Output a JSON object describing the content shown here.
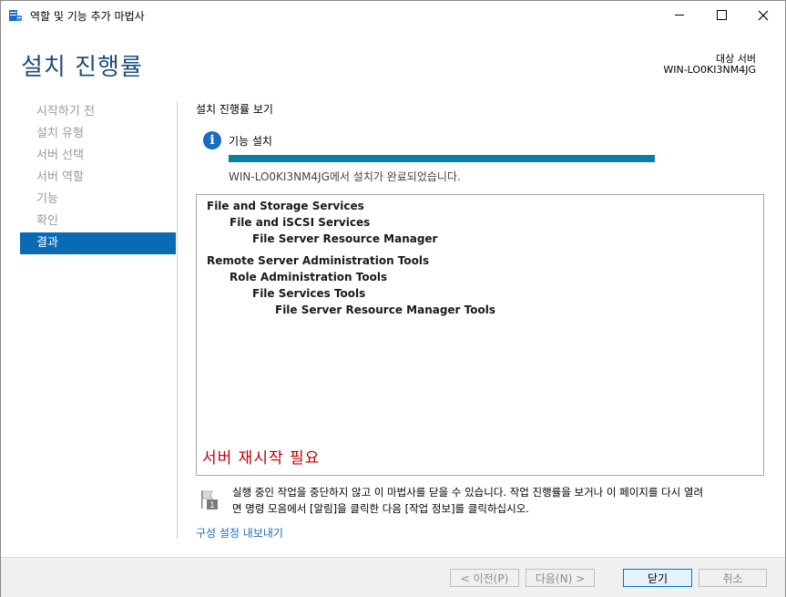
{
  "window": {
    "title": "역할 및 기능 추가 마법사"
  },
  "header": {
    "title": "설치 진행률",
    "destination_label": "대상 서버",
    "destination_server": "WIN-LO0KI3NM4JG"
  },
  "nav": {
    "items": [
      {
        "label": "시작하기 전",
        "active": false
      },
      {
        "label": "설치 유형",
        "active": false
      },
      {
        "label": "서버 선택",
        "active": false
      },
      {
        "label": "서버 역할",
        "active": false
      },
      {
        "label": "기능",
        "active": false
      },
      {
        "label": "확인",
        "active": false
      },
      {
        "label": "결과",
        "active": true
      }
    ]
  },
  "content": {
    "heading": "설치 진행률 보기",
    "info_icon": "info-icon",
    "feature_label": "기능 설치",
    "progress_fraction": 1.0,
    "status": "WIN-LO0KI3NM4JG에서 설치가 완료되었습니다.",
    "features": [
      {
        "label": "File and Storage Services",
        "level": 0
      },
      {
        "label": "File and iSCSI Services",
        "level": 1
      },
      {
        "label": "File Server Resource Manager",
        "level": 2
      },
      {
        "label": "Remote Server Administration Tools",
        "level": 0
      },
      {
        "label": "Role Administration Tools",
        "level": 1
      },
      {
        "label": "File Services Tools",
        "level": 2
      },
      {
        "label": "File Server Resource Manager Tools",
        "level": 3
      }
    ],
    "restart_required": "서버 재시작 필요",
    "note_line1": "실행 중인 작업을 중단하지 않고 이 마법사를 닫을 수 있습니다. 작업 진행률을 보거나 이 페이지를 다시 열려",
    "note_line2": "면 명령 모음에서 [알림]을 클릭한 다음 [작업 정보]를 클릭하십시오.",
    "note_badge": "1",
    "export_link": "구성 설정 내보내기"
  },
  "footer": {
    "prev": "< 이전(P)",
    "next": "다음(N) >",
    "close": "닫기",
    "cancel": "취소"
  },
  "colors": {
    "accent": "#0a6ab4",
    "title": "#1e4e79",
    "progress": "#0a7fa6",
    "restart": "#c00000"
  }
}
